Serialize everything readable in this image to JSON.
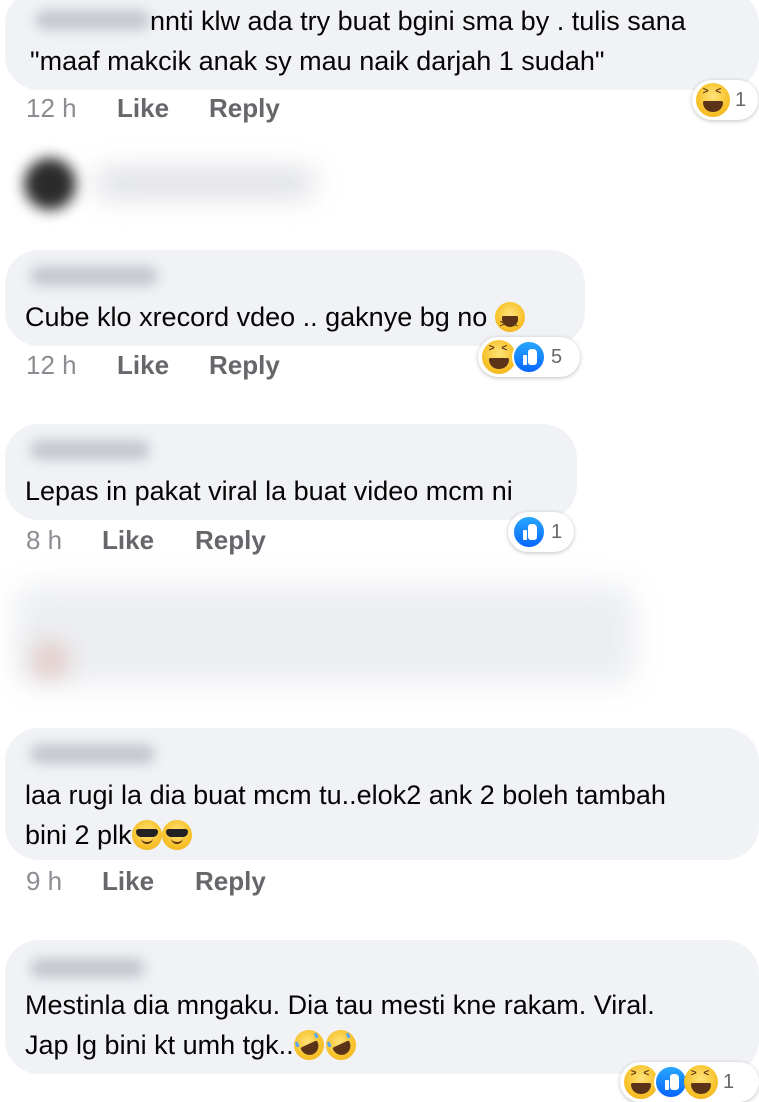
{
  "comments": [
    {
      "lines": [
        "nnti klw ada try buat bgini sma by . tulis sana",
        "\"maaf makcik anak sy mau naik darjah 1 sudah\""
      ],
      "time": "12 h",
      "like_label": "Like",
      "reply_label": "Reply",
      "reactions": {
        "icons": [
          "haha-icon"
        ],
        "count": "1"
      }
    },
    {
      "lines": [
        "Cube klo xrecord vdeo .. gaknye bg no"
      ],
      "inline_emoji": [
        "squinting-laugh-icon"
      ],
      "time": "12 h",
      "like_label": "Like",
      "reply_label": "Reply",
      "reactions": {
        "icons": [
          "haha-icon",
          "like-icon"
        ],
        "count": "5"
      }
    },
    {
      "lines": [
        "Lepas in pakat viral la buat video mcm ni"
      ],
      "time": "8 h",
      "like_label": "Like",
      "reply_label": "Reply",
      "reactions": {
        "icons": [
          "like-icon"
        ],
        "count": "1"
      }
    },
    {
      "lines": [
        "laa rugi la dia buat mcm tu..elok2 ank 2 boleh tambah",
        "bini 2 plk"
      ],
      "inline_emoji": [
        "sunglasses-icon",
        "sunglasses-icon"
      ],
      "time": "9 h",
      "like_label": "Like",
      "reply_label": "Reply"
    },
    {
      "lines": [
        "Mestinla dia mngaku. Dia tau mesti kne rakam. Viral.",
        "Jap lg bini kt umh tgk.."
      ],
      "inline_emoji": [
        "rofl-icon",
        "rofl-icon"
      ],
      "reactions": {
        "icons": [
          "haha-icon",
          "like-icon",
          "haha-icon"
        ],
        "count": "1"
      }
    }
  ],
  "colors": {
    "bubble": "#f0f2f5",
    "meta_text": "#65676b",
    "like_blue": "#0866ff",
    "haha_yellow": "#f8c22a"
  }
}
